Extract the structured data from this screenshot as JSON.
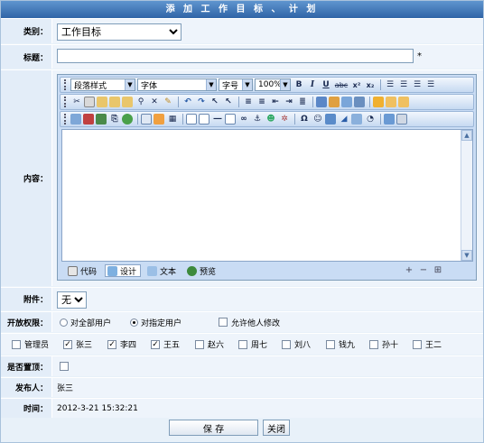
{
  "window": {
    "title": "添 加 工 作 目 标 、 计 划"
  },
  "category": {
    "label": "类别：",
    "value": "工作目标"
  },
  "title_field": {
    "label": "标题：",
    "value": "",
    "required_mark": "*"
  },
  "content": {
    "label": "内容：",
    "toolbar": {
      "paragraph_style": "段落样式",
      "font": "字体",
      "font_size": "字号",
      "zoom": "100%",
      "bold": "B",
      "italic": "I",
      "underline": "U",
      "strike": "abc",
      "superscript": "x²",
      "subscript": "x₂",
      "omega": "Ω"
    },
    "modes": [
      {
        "label": "代码",
        "icon": "code-icon"
      },
      {
        "label": "设计",
        "icon": "design-icon"
      },
      {
        "label": "文本",
        "icon": "text-icon"
      },
      {
        "label": "预览",
        "icon": "preview-icon"
      }
    ],
    "active_mode": "设计"
  },
  "attachment": {
    "label": "附件：",
    "value": "无"
  },
  "permissions": {
    "label": "开放权限：",
    "options": [
      "对全部用户",
      "对指定用户"
    ],
    "selected": "对指定用户",
    "allow_edit": "允许他人修改"
  },
  "users": [
    {
      "name": "管理员",
      "checked": false
    },
    {
      "name": "张三",
      "checked": true
    },
    {
      "name": "李四",
      "checked": true
    },
    {
      "name": "王五",
      "checked": true
    },
    {
      "name": "赵六",
      "checked": false
    },
    {
      "name": "周七",
      "checked": false
    },
    {
      "name": "刘八",
      "checked": false
    },
    {
      "name": "钱九",
      "checked": false
    },
    {
      "name": "孙十",
      "checked": false
    },
    {
      "name": "王二",
      "checked": false
    }
  ],
  "important": {
    "label": "是否置顶："
  },
  "publisher": {
    "label": "发布人：",
    "value": "张三"
  },
  "time": {
    "label": "时间：",
    "value": "2012-3-21 15:32:21"
  },
  "buttons": {
    "save": "保 存",
    "close": "关闭"
  },
  "colors": {
    "header": "#2f64a6",
    "label_bg": "#e3edf8",
    "value_bg": "#eef4fb"
  }
}
